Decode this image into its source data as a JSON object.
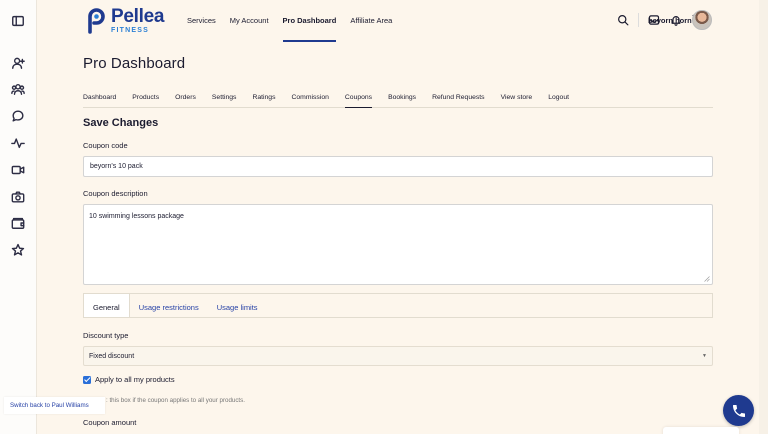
{
  "brand": {
    "name": "Pellea",
    "sub": "FITNESS",
    "primary": "#1f3a8f",
    "accent": "#2a7fd4"
  },
  "rail": {
    "icons": [
      "sidebar-toggle-icon",
      "user-plus-icon",
      "users-icon",
      "chat-icon",
      "activity-icon",
      "video-icon",
      "camera-icon",
      "wallet-icon",
      "star-icon"
    ]
  },
  "topnav": {
    "items": [
      {
        "label": "Services"
      },
      {
        "label": "My Account"
      },
      {
        "label": "Pro Dashboard",
        "active": true
      },
      {
        "label": "Affiliate Area"
      }
    ]
  },
  "header": {
    "icons": [
      "search-icon",
      "inbox-icon",
      "bell-icon",
      "cart-icon"
    ],
    "user_name": "beyorn horn"
  },
  "page": {
    "title": "Pro Dashboard",
    "section_title": "Save Changes"
  },
  "subnav": {
    "items": [
      {
        "label": "Dashboard"
      },
      {
        "label": "Products"
      },
      {
        "label": "Orders"
      },
      {
        "label": "Settings"
      },
      {
        "label": "Ratings"
      },
      {
        "label": "Commission"
      },
      {
        "label": "Coupons",
        "active": true
      },
      {
        "label": "Bookings"
      },
      {
        "label": "Refund Requests"
      },
      {
        "label": "View store"
      },
      {
        "label": "Logout"
      }
    ]
  },
  "form": {
    "coupon_code_label": "Coupon code",
    "coupon_code_value": "beyorn's 10 pack",
    "description_label": "Coupon description",
    "description_value": "10 swimming lessons package",
    "tabs": [
      {
        "label": "General",
        "active": true
      },
      {
        "label": "Usage restrictions"
      },
      {
        "label": "Usage limits"
      }
    ],
    "discount_type_label": "Discount type",
    "discount_type_value": "Fixed discount",
    "apply_all_label": "Apply to all my products",
    "apply_all_checked": true,
    "apply_all_help": ": this box if the coupon applies to all your products.",
    "coupon_amount_label": "Coupon amount"
  },
  "footer": {
    "switch_back": "Switch back to Paul Williams"
  }
}
